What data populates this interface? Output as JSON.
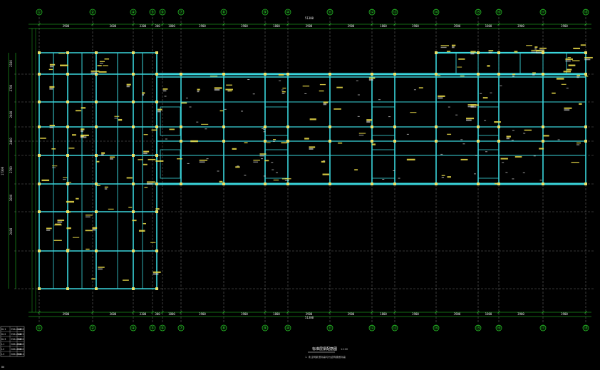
{
  "drawing": {
    "title": "标准层梁配筋图",
    "scale_note": "1:100",
    "note": "1. 未注明梁顶标高均为结构楼面标高",
    "corner_label": "B6",
    "total_dim_top": "51300",
    "total_dim_bottom": "51300",
    "left_total_dim": "17300"
  },
  "axes_top": [
    "①",
    "②",
    "④",
    "⑤",
    "⑥",
    "⑦",
    "⑧",
    "⑨",
    "⑩",
    "⑪",
    "⑫",
    "⑬",
    "⑭",
    "⑮",
    "⑯",
    "⑰",
    "⑱"
  ],
  "axes_bottom": [
    "①",
    "②",
    "④",
    "⑤",
    "⑥",
    "⑦",
    "⑧",
    "⑨",
    "⑩",
    "⑪",
    "⑫",
    "⑬",
    "⑭",
    "⑮",
    "⑯",
    "⑰",
    "⑱"
  ],
  "dims_top": [
    "3900",
    "3600",
    "3300",
    "300",
    "1800",
    "3900",
    "3900",
    "1800",
    "3900",
    "3900",
    "1800",
    "3900",
    "3900",
    "1800",
    "3900",
    "3900"
  ],
  "dims_bottom": [
    "3900",
    "3600",
    "3300",
    "300",
    "1800",
    "3900",
    "3900",
    "1800",
    "3900",
    "3900",
    "1800",
    "3900",
    "3900",
    "1800",
    "3900",
    "3900"
  ],
  "dims_left": [
    "2100",
    "2700",
    "2400",
    "2400",
    "2700",
    "3000",
    "2400"
  ],
  "schedule": {
    "rows": [
      [
        "KL1",
        "250x500",
        "4Φ20"
      ],
      [
        "KL2",
        "250x600",
        "4Φ22"
      ],
      [
        "KL3",
        "250x500",
        "3Φ20"
      ],
      [
        "L1",
        "200x400",
        "3Φ16"
      ],
      [
        "L2",
        "200x400",
        "2Φ16"
      ],
      [
        "L3",
        "200x300",
        "2Φ14"
      ]
    ]
  },
  "colors": {
    "grid": "#2bd62b",
    "beam": "#3ad6dc",
    "column": "#e8e26a",
    "annotation": "#f0e14a",
    "dim": "#e6e6e6",
    "axis_line": "#9a9a9a"
  }
}
